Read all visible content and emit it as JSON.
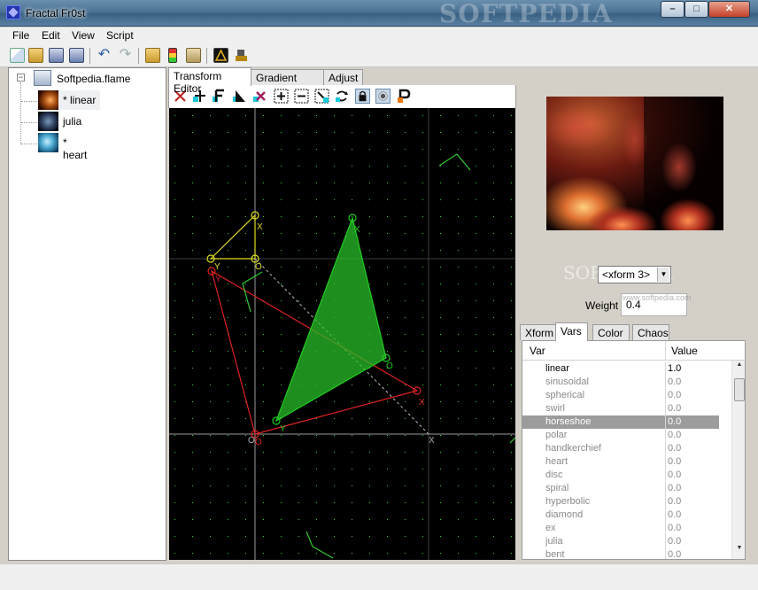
{
  "window": {
    "title": "Fractal Fr0st",
    "watermark": "SOFTPEDIA",
    "minimize_glyph": "–",
    "maximize_glyph": "□",
    "close_glyph": "✕"
  },
  "menu": [
    {
      "label": "File"
    },
    {
      "label": "Edit"
    },
    {
      "label": "View"
    },
    {
      "label": "Script"
    }
  ],
  "toolbar": {
    "icons": [
      "new-flame-icon",
      "open-icon",
      "save-icon",
      "save-as-icon",
      "undo-icon",
      "redo-icon",
      "open-script-icon",
      "run-script-icon",
      "edit-script-icon",
      "render-icon",
      "render-queue-icon"
    ]
  },
  "tree": {
    "root": {
      "label": "Softpedia.flame",
      "expander": "−"
    },
    "items": [
      {
        "label": "* linear",
        "selected": true
      },
      {
        "label": "julia",
        "selected": false
      },
      {
        "label": "* heart",
        "selected": false
      }
    ]
  },
  "editor": {
    "tabs": [
      {
        "label": "Transform Editor",
        "active": true
      },
      {
        "label": "Gradient Editor",
        "active": false
      },
      {
        "label": "Adjust",
        "active": false
      }
    ],
    "tools": [
      "delete-xform-icon",
      "add-xform-icon",
      "duplicate-xform-icon",
      "reset-triangle-icon",
      "reset-xform-icon",
      "zoom-in-icon",
      "zoom-out-icon",
      "zoom-to-fit-icon",
      "flip-icon",
      "lock-icon",
      "world-pivot-icon",
      "post-transform-icon"
    ],
    "canvas": {
      "grid_color": "#3c3c3c",
      "axis_color": "#9a9a9a",
      "dot_color": "#44cc44",
      "triangles": [
        {
          "name": "xform-1",
          "color": "#dddd22",
          "labels": [
            "X",
            "Y",
            "O"
          ]
        },
        {
          "name": "xform-2",
          "color": "#dd2222",
          "labels": [
            "X",
            "Y",
            "O"
          ]
        },
        {
          "name": "xform-3",
          "color": "#22cc22",
          "labels": [
            "X",
            "Y",
            "O"
          ],
          "filled": true
        }
      ],
      "origin_labels": [
        "O",
        "X"
      ]
    }
  },
  "right": {
    "xform_select": "<xform 3>",
    "weight_label": "Weight",
    "weight_value": "0.4",
    "watermark": "SOFTPEDIA",
    "watermark_small": "www.softpedia.com"
  },
  "var_tabs": [
    {
      "label": "Xform",
      "active": false
    },
    {
      "label": "Vars",
      "active": true
    },
    {
      "label": "Color",
      "active": false
    },
    {
      "label": "Chaos",
      "active": false
    }
  ],
  "var_table": {
    "columns": [
      "Var",
      "Value"
    ],
    "rows": [
      {
        "name": "linear",
        "value": "1.0",
        "state": "active"
      },
      {
        "name": "sinusoidal",
        "value": "0.0",
        "state": "normal"
      },
      {
        "name": "spherical",
        "value": "0.0",
        "state": "normal"
      },
      {
        "name": "swirl",
        "value": "0.0",
        "state": "normal"
      },
      {
        "name": "horseshoe",
        "value": "0.0",
        "state": "selected"
      },
      {
        "name": "polar",
        "value": "0.0",
        "state": "normal"
      },
      {
        "name": "handkerchief",
        "value": "0.0",
        "state": "normal"
      },
      {
        "name": "heart",
        "value": "0.0",
        "state": "normal"
      },
      {
        "name": "disc",
        "value": "0.0",
        "state": "normal"
      },
      {
        "name": "spiral",
        "value": "0.0",
        "state": "normal"
      },
      {
        "name": "hyperbolic",
        "value": "0.0",
        "state": "normal"
      },
      {
        "name": "diamond",
        "value": "0.0",
        "state": "normal"
      },
      {
        "name": "ex",
        "value": "0.0",
        "state": "normal"
      },
      {
        "name": "julia",
        "value": "0.0",
        "state": "normal"
      },
      {
        "name": "bent",
        "value": "0.0",
        "state": "normal"
      }
    ]
  }
}
